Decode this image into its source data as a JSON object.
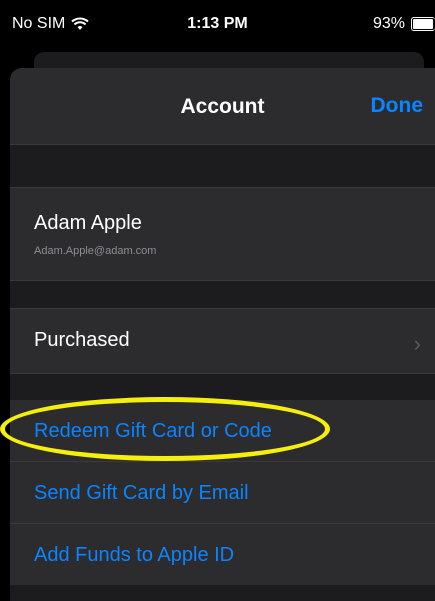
{
  "status_bar": {
    "carrier": "No SIM",
    "time": "1:13 PM",
    "battery": "93%",
    "battery_level": 0.93
  },
  "nav": {
    "title": "Account",
    "done_label": "Done"
  },
  "account": {
    "name": "Adam Apple",
    "email": "Adam.Apple@adam.com"
  },
  "purchased": {
    "label": "Purchased"
  },
  "links": [
    {
      "label": "Redeem Gift Card or Code"
    },
    {
      "label": "Send Gift Card by Email"
    },
    {
      "label": "Add Funds to Apple ID"
    }
  ],
  "colors": {
    "accent": "#0a84ff",
    "highlight": "#f5ef0b",
    "cell": "#2c2c2e",
    "background": "#1c1c1e"
  },
  "icons": {
    "wifi": "wifi-icon",
    "battery": "battery-icon",
    "chevron": "chevron-right-icon"
  }
}
